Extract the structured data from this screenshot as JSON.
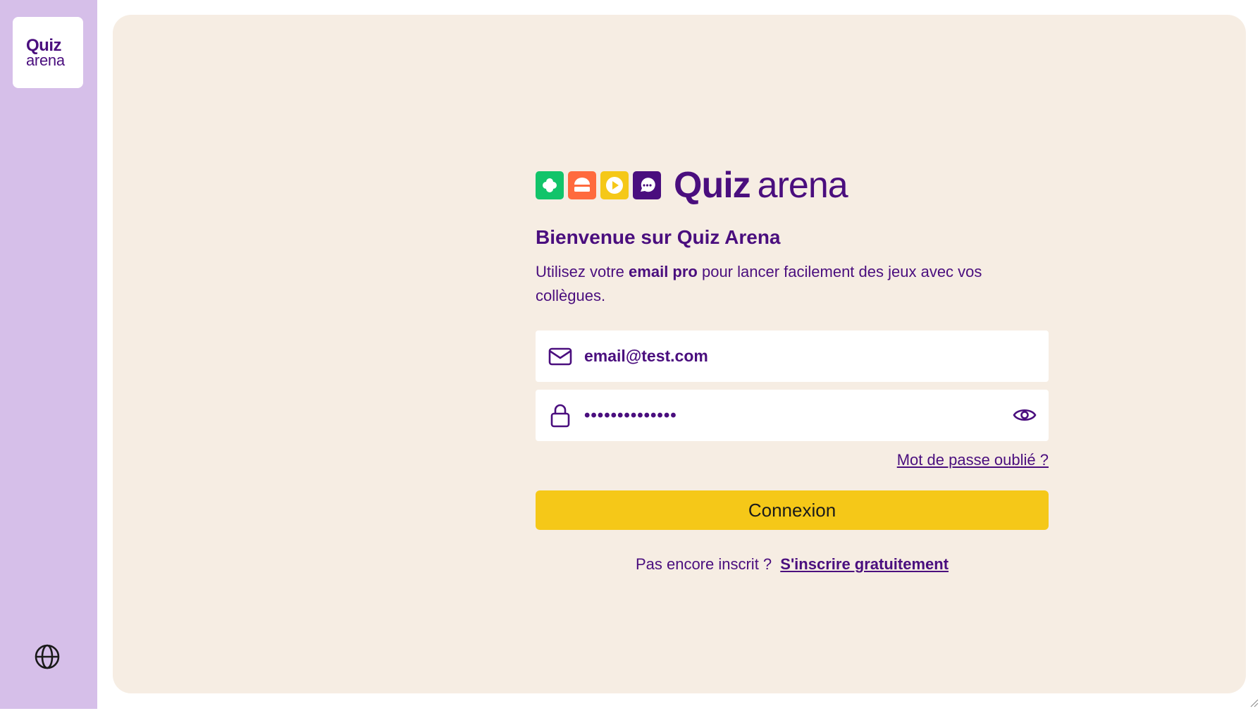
{
  "sidebar": {
    "logo_line1": "Quiz",
    "logo_line2": "arena",
    "language_icon": "globe-icon"
  },
  "brand": {
    "word1": "Quiz",
    "word2": "arena",
    "tiles": [
      {
        "color": "#12c46a",
        "icon": "flower-icon"
      },
      {
        "color": "#ff6a3d",
        "icon": "burger-icon"
      },
      {
        "color": "#f5c818",
        "icon": "play-icon"
      },
      {
        "color": "#4a0e7e",
        "icon": "chat-bubble-icon"
      }
    ]
  },
  "login": {
    "title": "Bienvenue sur Quiz Arena",
    "subtitle_before": "Utilisez votre ",
    "subtitle_bold": "email pro",
    "subtitle_after": " pour lancer facilement des jeux avec vos collègues.",
    "email_value": "email@test.com",
    "password_value": "••••••••••••••",
    "forgot_link": "Mot de passe oublié ?",
    "submit_label": "Connexion",
    "signup_prompt": "Pas encore inscrit ?",
    "signup_link": "S'inscrire gratuitement"
  },
  "colors": {
    "primary": "#4a0e7e",
    "sidebar_bg": "#d6bfe9",
    "card_bg": "#f6ede3",
    "button_bg": "#f5c818"
  }
}
